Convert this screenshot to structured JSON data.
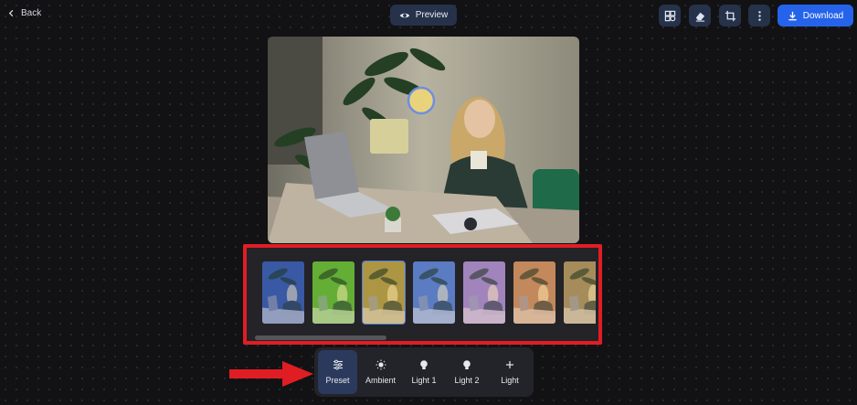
{
  "topbar": {
    "back_label": "Back",
    "preview_label": "Preview",
    "download_label": "Download",
    "tools": [
      "compare-icon",
      "eraser-icon",
      "crop-icon",
      "more-vertical-icon"
    ]
  },
  "colors": {
    "accent": "#2563eb",
    "highlight": "#e11d24",
    "panel": "#23242a",
    "background": "#121214"
  },
  "presets": [
    {
      "name": "preset-1",
      "tint": "#3f63c8",
      "selected": false
    },
    {
      "name": "preset-2",
      "tint": "#76d23a",
      "selected": false
    },
    {
      "name": "preset-3",
      "tint": "#d3b24a",
      "selected": true
    },
    {
      "name": "preset-4",
      "tint": "#6a8ff0",
      "selected": false
    },
    {
      "name": "preset-5",
      "tint": "#c79be8",
      "selected": false
    },
    {
      "name": "preset-6",
      "tint": "#f0a06a",
      "selected": false
    },
    {
      "name": "preset-7",
      "tint": "#caa56a",
      "selected": false
    }
  ],
  "dock": {
    "items": [
      {
        "label": "Preset",
        "icon": "sliders-icon",
        "active": true
      },
      {
        "label": "Ambient",
        "icon": "sun-icon",
        "active": false
      },
      {
        "label": "Light 1",
        "icon": "bulb-icon",
        "active": false
      },
      {
        "label": "Light 2",
        "icon": "bulb-icon",
        "active": false
      },
      {
        "label": "Light",
        "icon": "plus-icon",
        "active": false
      }
    ]
  }
}
